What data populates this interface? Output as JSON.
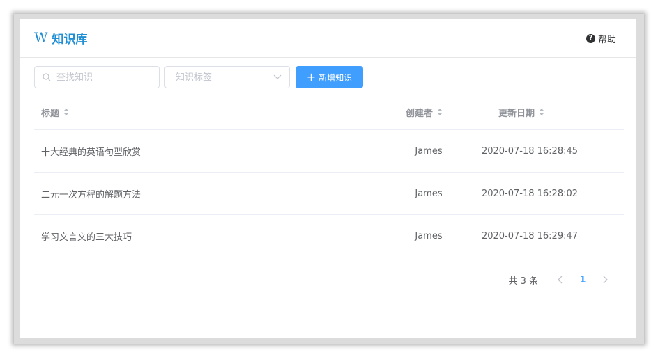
{
  "header": {
    "logo_mark": "W",
    "title": "知识库",
    "help_icon": "?",
    "help_label": "帮助"
  },
  "toolbar": {
    "search_placeholder": "查找知识",
    "search_value": "",
    "tag_placeholder": "知识标签",
    "add_label": "新增知识",
    "add_icon": "+"
  },
  "table": {
    "columns": {
      "title": "标题",
      "author": "创建者",
      "date": "更新日期"
    },
    "rows": [
      {
        "title": "十大经典的英语句型欣赏",
        "author": "James",
        "date": "2020-07-18 16:28:45"
      },
      {
        "title": "二元一次方程的解题方法",
        "author": "James",
        "date": "2020-07-18 16:28:02"
      },
      {
        "title": "学习文言文的三大技巧",
        "author": "James",
        "date": "2020-07-18 16:29:47"
      }
    ]
  },
  "pagination": {
    "total_text": "共 3 条",
    "prev_icon": "‹",
    "next_icon": "›",
    "current_page": "1"
  },
  "colors": {
    "primary": "#409eff",
    "brand": "#1f8ed4"
  }
}
